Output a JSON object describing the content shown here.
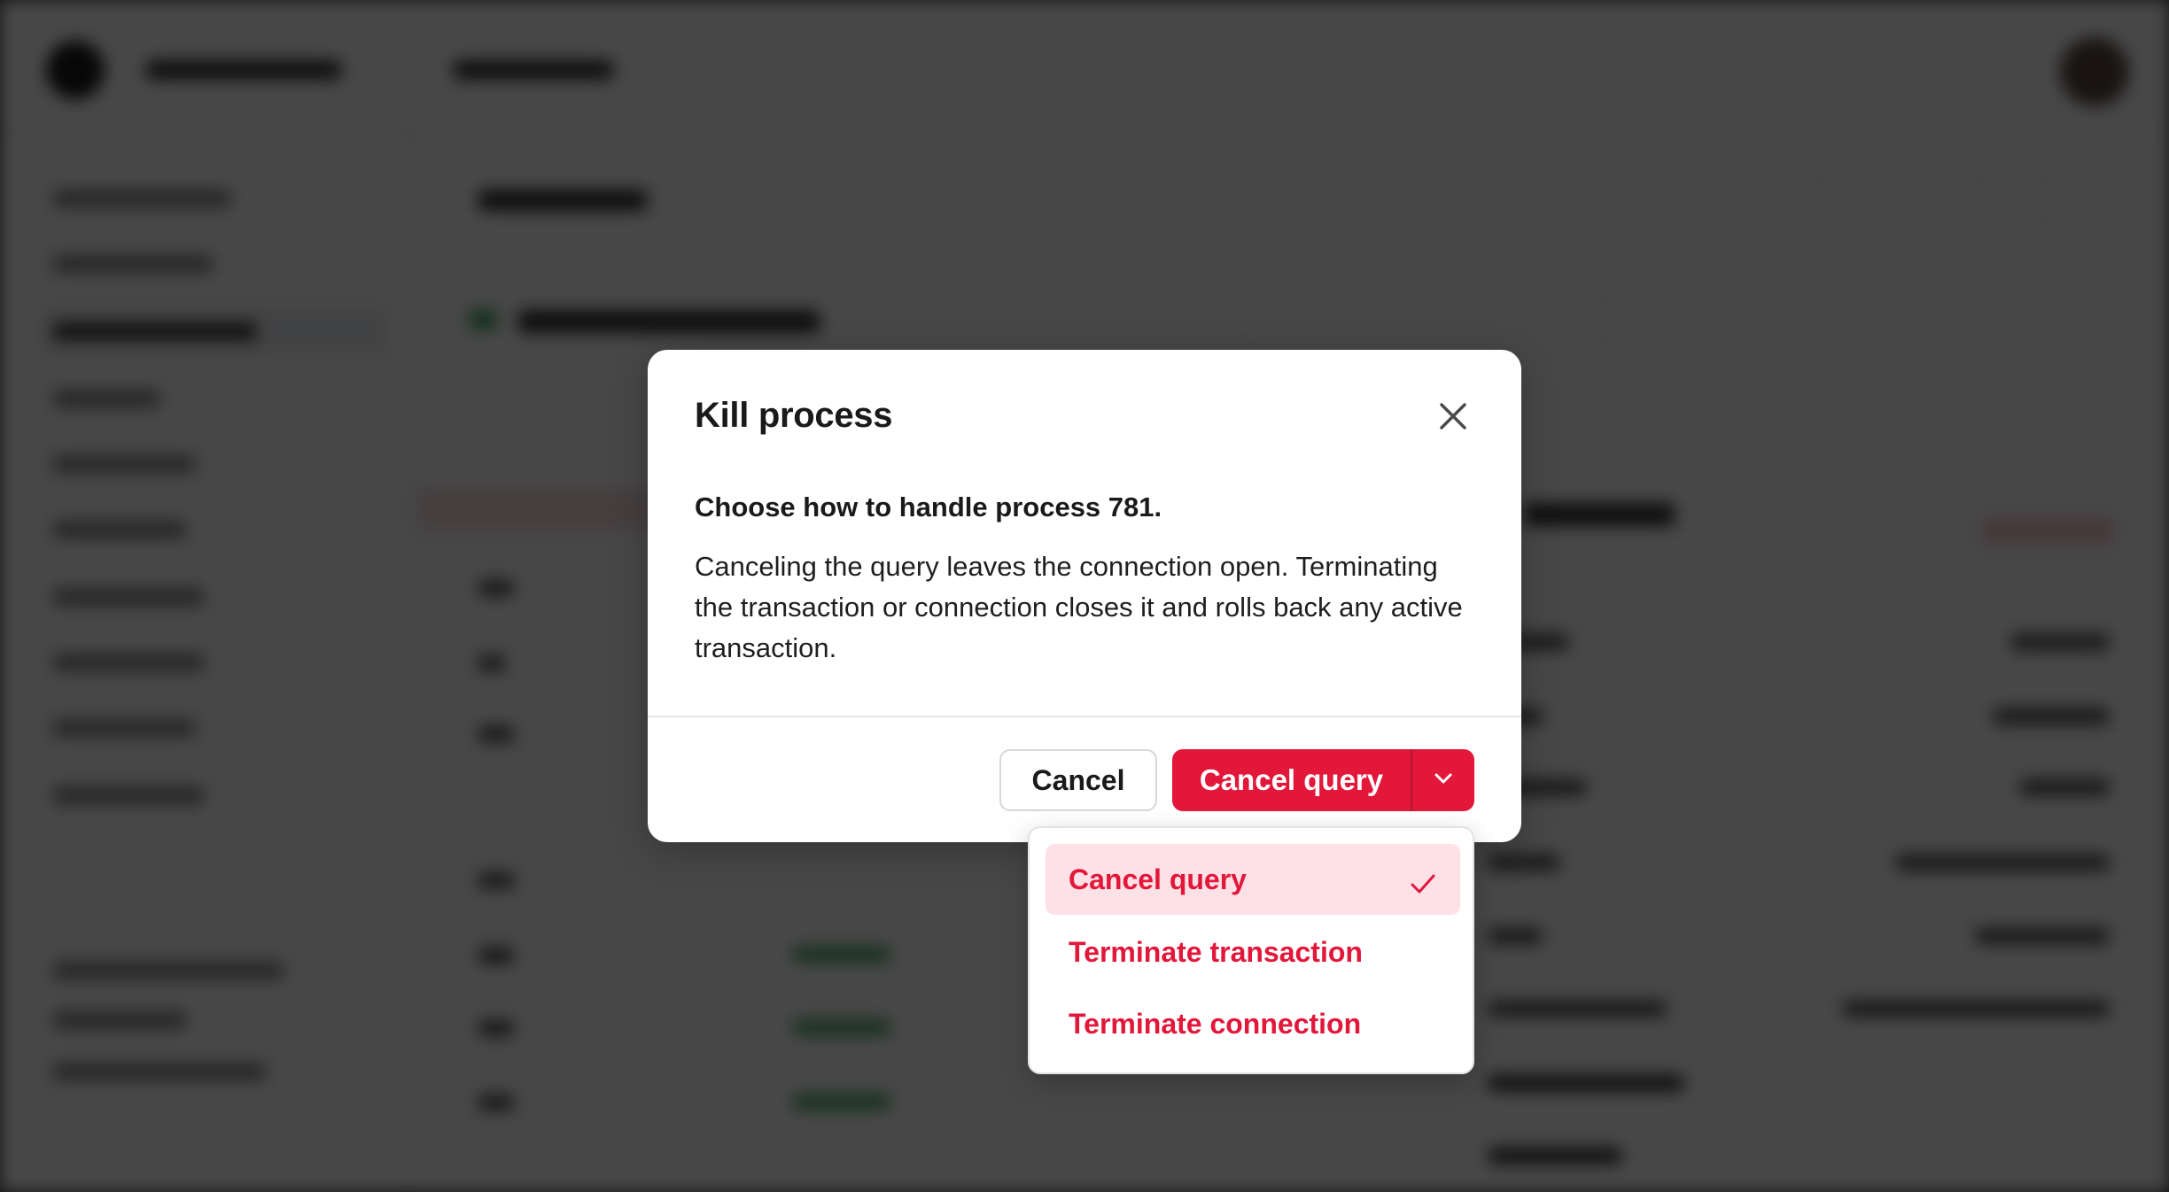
{
  "modal": {
    "title": "Kill process",
    "subtitle": "Choose how to handle process 781.",
    "description": "Canceling the query leaves the connection open. Terminating the transaction or connection closes it and rolls back any active transaction.",
    "cancel_label": "Cancel",
    "primary_action_label": "Cancel query"
  },
  "menu": {
    "items": [
      {
        "label": "Cancel query",
        "selected": true
      },
      {
        "label": "Terminate transaction",
        "selected": false
      },
      {
        "label": "Terminate connection",
        "selected": false
      }
    ]
  },
  "icons": {
    "close": "close-icon",
    "caret": "chevron-down-icon",
    "check": "check-icon"
  },
  "colors": {
    "danger": "#e2173a",
    "danger_selected_bg": "#fde1e6",
    "overlay": "rgba(0,0,0,0.72)"
  }
}
